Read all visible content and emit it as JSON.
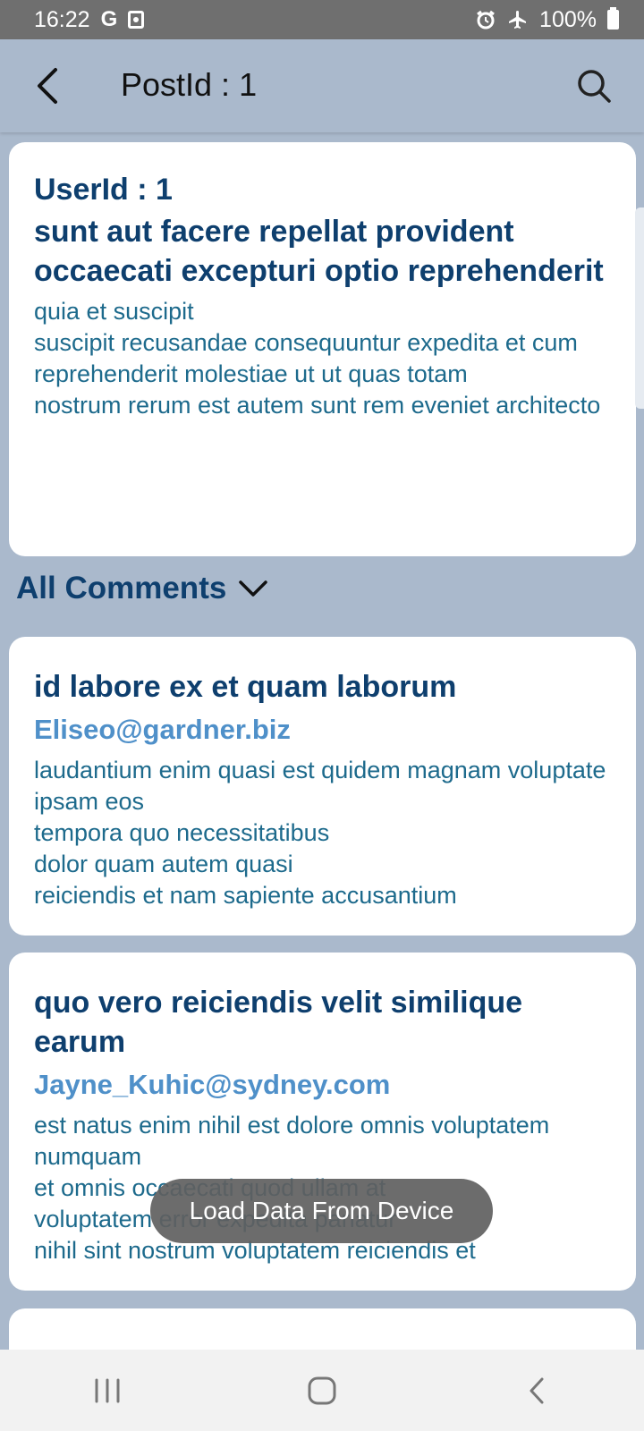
{
  "status_bar": {
    "time": "16:22",
    "left_icons": [
      "g-icon",
      "screenshot-icon"
    ],
    "right_icons": [
      "alarm-icon",
      "airplane-icon",
      "battery-icon"
    ],
    "battery": "100%"
  },
  "app_bar": {
    "title": "PostId : 1",
    "back_icon": "back-arrow-icon",
    "search_icon": "search-icon"
  },
  "post": {
    "user_id": "UserId : 1",
    "title": "sunt aut facere repellat provident occaecati excepturi optio reprehenderit",
    "body": "quia et suscipit\nsuscipit recusandae consequuntur expedita et cum\nreprehenderit molestiae ut ut quas totam\nnostrum rerum est autem sunt rem eveniet architecto"
  },
  "comments_section": {
    "label": "All Comments",
    "toggle_icon": "chevron-down-icon"
  },
  "comments": [
    {
      "name": "id labore ex et quam laborum",
      "email": "Eliseo@gardner.biz",
      "body": "laudantium enim quasi est quidem magnam voluptate ipsam eos\ntempora quo necessitatibus\ndolor quam autem quasi\nreiciendis et nam sapiente accusantium"
    },
    {
      "name": "quo vero reiciendis velit similique earum",
      "email": "Jayne_Kuhic@sydney.com",
      "body": "est natus enim nihil est dolore omnis voluptatem numquam\net omnis occaecati quod ullam at\nvoluptatem error expedita pariatur\nnihil sint nostrum voluptatem reiciendis et"
    }
  ],
  "toast": "Load Data From Device",
  "nav_bar": {
    "icons": [
      "recent-apps-icon",
      "home-icon",
      "back-icon"
    ]
  },
  "colors": {
    "background": "#aab9cc",
    "title_text": "#0e3f6e",
    "body_text": "#1d6a8c",
    "email_text": "#4f90c9"
  }
}
